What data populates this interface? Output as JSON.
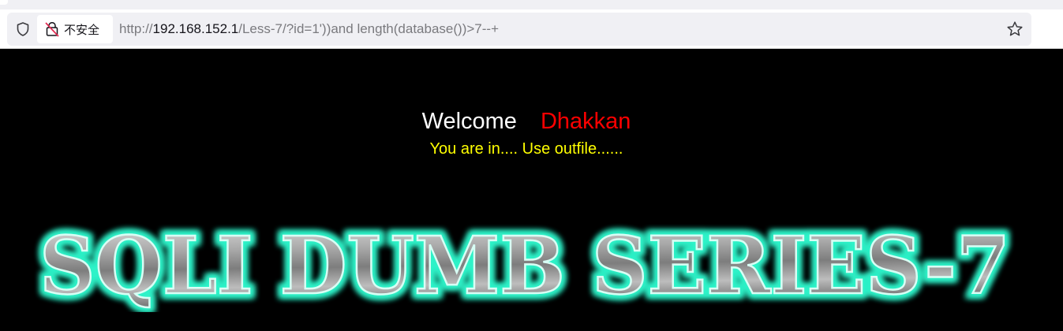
{
  "browser": {
    "security_label": "不安全",
    "url_scheme": "http://",
    "url_host": "192.168.152.1",
    "url_rest": "/Less-7/?id=1'))and length(database())>7--+"
  },
  "page": {
    "welcome": "Welcome",
    "name": "Dhakkan",
    "status": "You are in.... Use outfile......",
    "banner_text": "SQLI DUMB SERIES-7"
  },
  "colors": {
    "welcome": "#ffffff",
    "name": "#ff0000",
    "status": "#ffff00",
    "banner_glow": "#2ef2c8"
  },
  "icons": {
    "tracking": "shield-icon",
    "insecure": "broken-lock-icon",
    "bookmark": "star-icon"
  }
}
